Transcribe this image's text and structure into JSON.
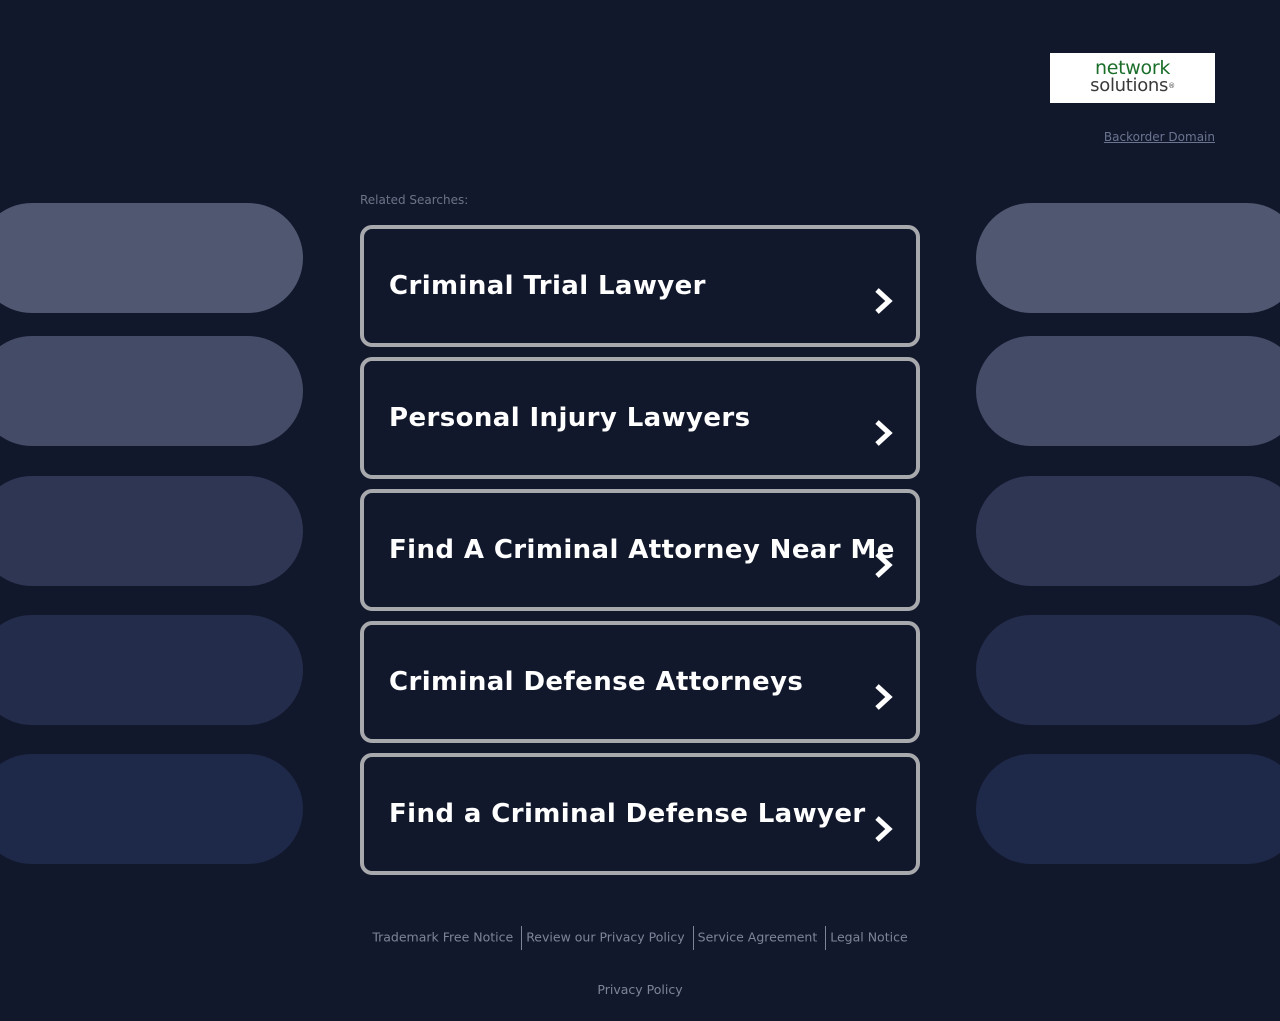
{
  "header": {
    "logo_line1": "network",
    "logo_line2": "solutions",
    "logo_reg": "®",
    "backorder_label": "Backorder Domain"
  },
  "related": {
    "label": "Related Searches:",
    "items": [
      {
        "label": "Criminal Trial Lawyer"
      },
      {
        "label": "Personal Injury Lawyers"
      },
      {
        "label": "Find A Criminal Attorney Near Me"
      },
      {
        "label": "Criminal Defense Attorneys"
      },
      {
        "label": "Find a Criminal Defense Lawyer"
      }
    ]
  },
  "footer": {
    "links": [
      "Trademark Free Notice",
      "Review our Privacy Policy",
      "Service Agreement",
      "Legal Notice"
    ],
    "privacy_label": "Privacy Policy"
  },
  "icons": {
    "search_item_arrow": "chevron-right-icon"
  },
  "colors": {
    "background": "#12182c",
    "item_border": "#a8a9ad",
    "item_text": "#ffffff",
    "muted_text": "#7d8499",
    "logo_green": "#1a6e2a"
  }
}
